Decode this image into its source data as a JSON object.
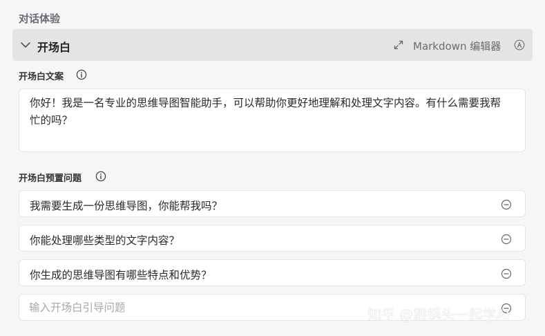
{
  "section": {
    "title": "对话体验"
  },
  "header": {
    "title": "开场白",
    "editor_label": "Markdown 编辑器"
  },
  "opening": {
    "label": "开场白文案",
    "text": "你好！我是一名专业的思维导图智能助手，可以帮助你更好地理解和处理文字内容。有什么需要我帮忙的吗？"
  },
  "preset": {
    "label": "开场白预置问题",
    "questions": [
      {
        "text": "我需要生成一份思维导图，你能帮我吗？"
      },
      {
        "text": "你能处理哪些类型的文字内容？"
      },
      {
        "text": "你生成的思维导图有哪些特点和优势？"
      }
    ],
    "input_placeholder": "输入开场白引导问题",
    "input_value": ""
  },
  "icons": {
    "collapse": "chevron-down-icon",
    "expand": "expand-icon",
    "markdown": "circle-a-icon",
    "info": "info-icon",
    "remove": "minus-circle-icon"
  },
  "watermark": "知乎 @跟锅头一起学AI"
}
